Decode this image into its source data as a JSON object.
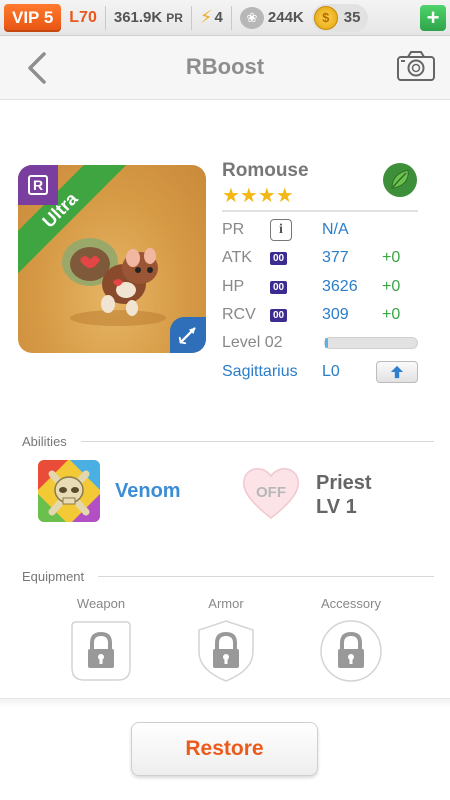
{
  "status_bar": {
    "vip": "VIP 5",
    "level": "L70",
    "pr_value": "361.9K",
    "pr_label": "PR",
    "energy": "4",
    "paw_count": "244K",
    "coins": "35"
  },
  "nav": {
    "title": "RBoost"
  },
  "card": {
    "rarity": "R",
    "tier": "Ultra"
  },
  "monster": {
    "name": "Romouse",
    "stars": "★★★★",
    "stats": {
      "pr": {
        "label": "PR",
        "value": "N/A"
      },
      "atk": {
        "label": "ATK",
        "tag": "00",
        "value": "377",
        "bonus": "+0"
      },
      "hp": {
        "label": "HP",
        "tag": "00",
        "value": "3626",
        "bonus": "+0"
      },
      "rcv": {
        "label": "RCV",
        "tag": "00",
        "value": "309",
        "bonus": "+0"
      }
    },
    "level_label": "Level 02",
    "level_progress": 0.03,
    "sign": "Sagittarius",
    "sign_level": "L0"
  },
  "abilities": {
    "heading": "Abilities",
    "skill_name": "Venom",
    "off_label": "OFF",
    "class_name": "Priest",
    "class_level": "LV 1"
  },
  "equipment": {
    "heading": "Equipment",
    "slots": [
      "Weapon",
      "Armor",
      "Accessory"
    ]
  },
  "actions": {
    "restore": "Restore"
  },
  "colors": {
    "accent_orange": "#ea5b1c",
    "stat_blue": "#2a7dc9",
    "bonus_green": "#3aa544",
    "ultra_green": "#3ea541"
  }
}
